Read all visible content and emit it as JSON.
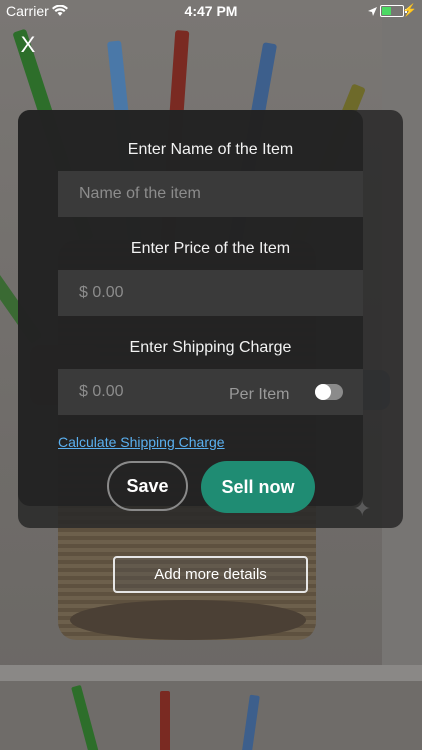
{
  "status_bar": {
    "carrier": "Carrier",
    "time": "4:47 PM"
  },
  "close_label": "X",
  "form": {
    "name": {
      "label": "Enter Name of the Item",
      "placeholder": "Name of the item",
      "value": ""
    },
    "price": {
      "label": "Enter Price of the Item",
      "placeholder": "$ 0.00",
      "value": ""
    },
    "shipping": {
      "label": "Enter Shipping Charge",
      "placeholder": "$ 0.00",
      "value": "",
      "per_item_label": "Per Item",
      "per_item_on": false
    },
    "calc_link": "Calculate Shipping Charge",
    "save_label": "Save",
    "sell_label": "Sell now"
  },
  "add_more_label": "Add more details",
  "colors": {
    "accent": "#1f8c73",
    "link": "#5ab0f0",
    "card": "#232323",
    "field": "#3a3a3a"
  },
  "icons": [
    "wifi-icon",
    "location-arrow-icon",
    "battery-icon",
    "charging-bolt-icon",
    "close-icon",
    "sparkle-icon"
  ]
}
